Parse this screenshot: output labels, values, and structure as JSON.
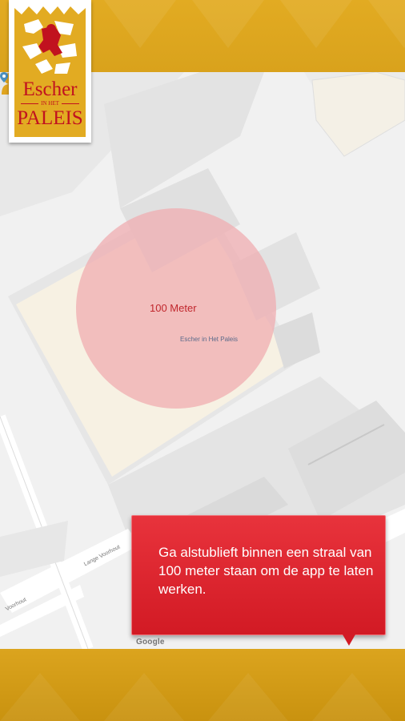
{
  "header": {
    "logo": {
      "line1": "Escher",
      "line2": "IN HET",
      "line3": "PALEIS"
    }
  },
  "map": {
    "radius_label": "100 Meter",
    "place_label": "Escher in Het Paleis",
    "streets": [
      "Lange Voorhout",
      "Voorhout"
    ],
    "attribution": "Google",
    "radius_color": "#f0aaaf"
  },
  "tooltip": {
    "message": "Ga alstublieft binnen een straal van 100 meter staan om de app te laten werken."
  },
  "colors": {
    "gold": "#e2ab22",
    "red": "#d21a24",
    "label_red": "#c1272d"
  }
}
